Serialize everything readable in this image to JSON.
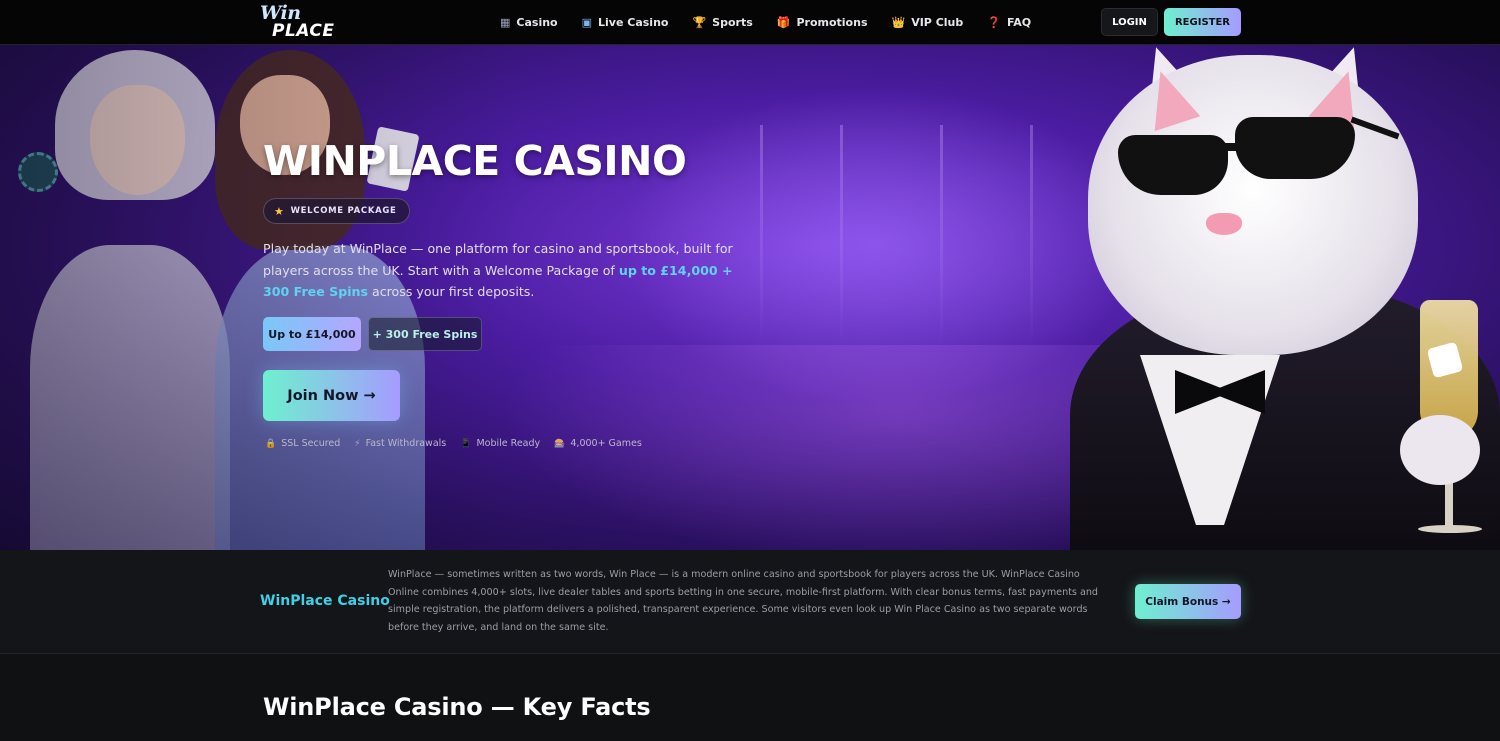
{
  "header": {
    "logo_line1": "Win",
    "logo_line2": "PLACE",
    "nav": [
      {
        "icon": "slot-icon",
        "glyph": "▦",
        "label": "Casino"
      },
      {
        "icon": "live-casino-icon",
        "glyph": "▣",
        "label": "Live Casino"
      },
      {
        "icon": "trophy-icon",
        "glyph": "🏆",
        "label": "Sports"
      },
      {
        "icon": "gift-icon",
        "glyph": "🎁",
        "label": "Promotions"
      },
      {
        "icon": "crown-icon",
        "glyph": "👑",
        "label": "VIP Club"
      },
      {
        "icon": "question-icon",
        "glyph": "❓",
        "label": "FAQ"
      }
    ],
    "login_label": "LOGIN",
    "register_label": "REGISTER"
  },
  "hero": {
    "title": "WINPLACE CASINO",
    "badge": "WELCOME PACKAGE",
    "desc_part1": "Play today at WinPlace — one platform for casino and sportsbook, built for players across the UK. Start with a Welcome Package of ",
    "desc_highlight": "up to £14,000 + 300 Free Spins",
    "desc_part2": " across your first deposits.",
    "pill_amount": "Up to £14,000",
    "pill_spins": "+ 300 Free Spins",
    "join_label": "Join Now →",
    "trust": [
      {
        "icon": "lock-icon",
        "glyph": "🔒",
        "label": "SSL Secured"
      },
      {
        "icon": "lightning-icon",
        "glyph": "⚡",
        "label": "Fast Withdrawals"
      },
      {
        "icon": "mobile-icon",
        "glyph": "📱",
        "label": "Mobile Ready"
      },
      {
        "icon": "games-icon",
        "glyph": "🎰",
        "label": "4,000+ Games"
      }
    ]
  },
  "intro": {
    "title": "WinPlace Casino",
    "text": "WinPlace — sometimes written as two words, Win Place — is a modern online casino and sportsbook for players across the UK. WinPlace Casino Online combines 4,000+ slots, live dealer tables and sports betting in one secure, mobile-first platform. With clear bonus terms, fast payments and simple registration, the platform delivers a polished, transparent experience. Some visitors even look up Win Place Casino as two separate words before they arrive, and land on the same site.",
    "claim_label": "Claim Bonus →"
  },
  "facts": {
    "title": "WinPlace Casino — Key Facts"
  }
}
